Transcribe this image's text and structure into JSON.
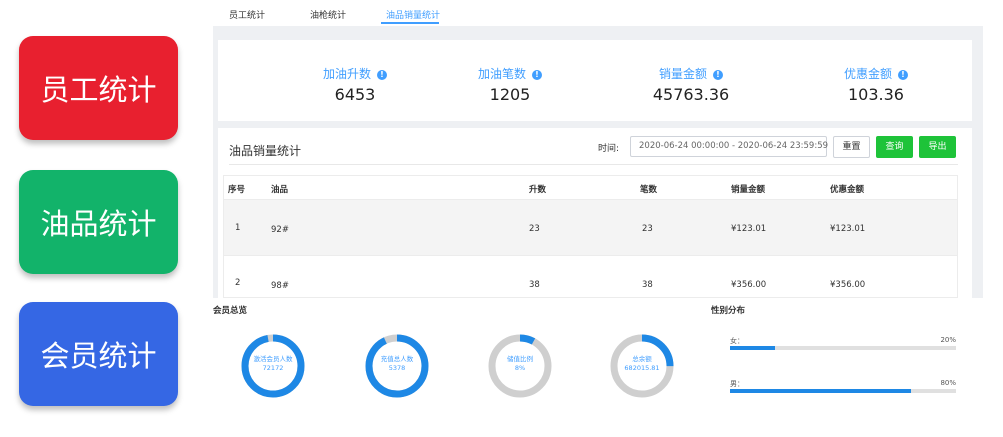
{
  "categories": [
    {
      "label": "员工统计",
      "color": "#e8202f"
    },
    {
      "label": "油品统计",
      "color": "#12b36a"
    },
    {
      "label": "会员统计",
      "color": "#3567e4"
    }
  ],
  "tabs": [
    {
      "label": "员工统计",
      "active": false
    },
    {
      "label": "油枪统计",
      "active": false
    },
    {
      "label": "油品销量统计",
      "active": true
    }
  ],
  "stats": [
    {
      "label": "加油升数",
      "value": "6453"
    },
    {
      "label": "加油笔数",
      "value": "1205"
    },
    {
      "label": "销量金额",
      "value": "45763.36"
    },
    {
      "label": "优惠金额",
      "value": "103.36"
    }
  ],
  "info_icon_glyph": "!",
  "sales_card": {
    "title": "油品销量统计",
    "time_label": "时间:",
    "date_range": "2020-06-24 00:00:00 - 2020-06-24 23:59:59",
    "reset_label": "重置",
    "query_label": "查询",
    "export_label": "导出"
  },
  "table": {
    "headers": [
      "序号",
      "油品",
      "升数",
      "笔数",
      "销量金额",
      "优惠金额"
    ],
    "rows": [
      [
        "1",
        "92#",
        "23",
        "23",
        "¥123.01",
        "¥123.01"
      ],
      [
        "2",
        "98#",
        "38",
        "38",
        "¥356.00",
        "¥356.00"
      ]
    ]
  },
  "member_overview": {
    "title": "会员总览",
    "donuts": [
      {
        "label": "激活会员人数",
        "value": "72172",
        "fraction": 0.97
      },
      {
        "label": "充值总人数",
        "value": "5378",
        "fraction": 0.93
      },
      {
        "label": "储值比例",
        "value": "8%",
        "fraction": 0.08
      },
      {
        "label": "总余额",
        "value": "682015.81",
        "fraction": 0.25
      }
    ]
  },
  "gender": {
    "title": "性别分布",
    "items": [
      {
        "label": "女：",
        "percent_text": "20%",
        "fraction": 0.2
      },
      {
        "label": "男：",
        "percent_text": "80%",
        "fraction": 0.8
      }
    ]
  },
  "colors": {
    "accent": "#409eff",
    "green_button": "#1ec339",
    "donut_fill": "#1e88e5",
    "donut_track": "#cfcfcf"
  }
}
